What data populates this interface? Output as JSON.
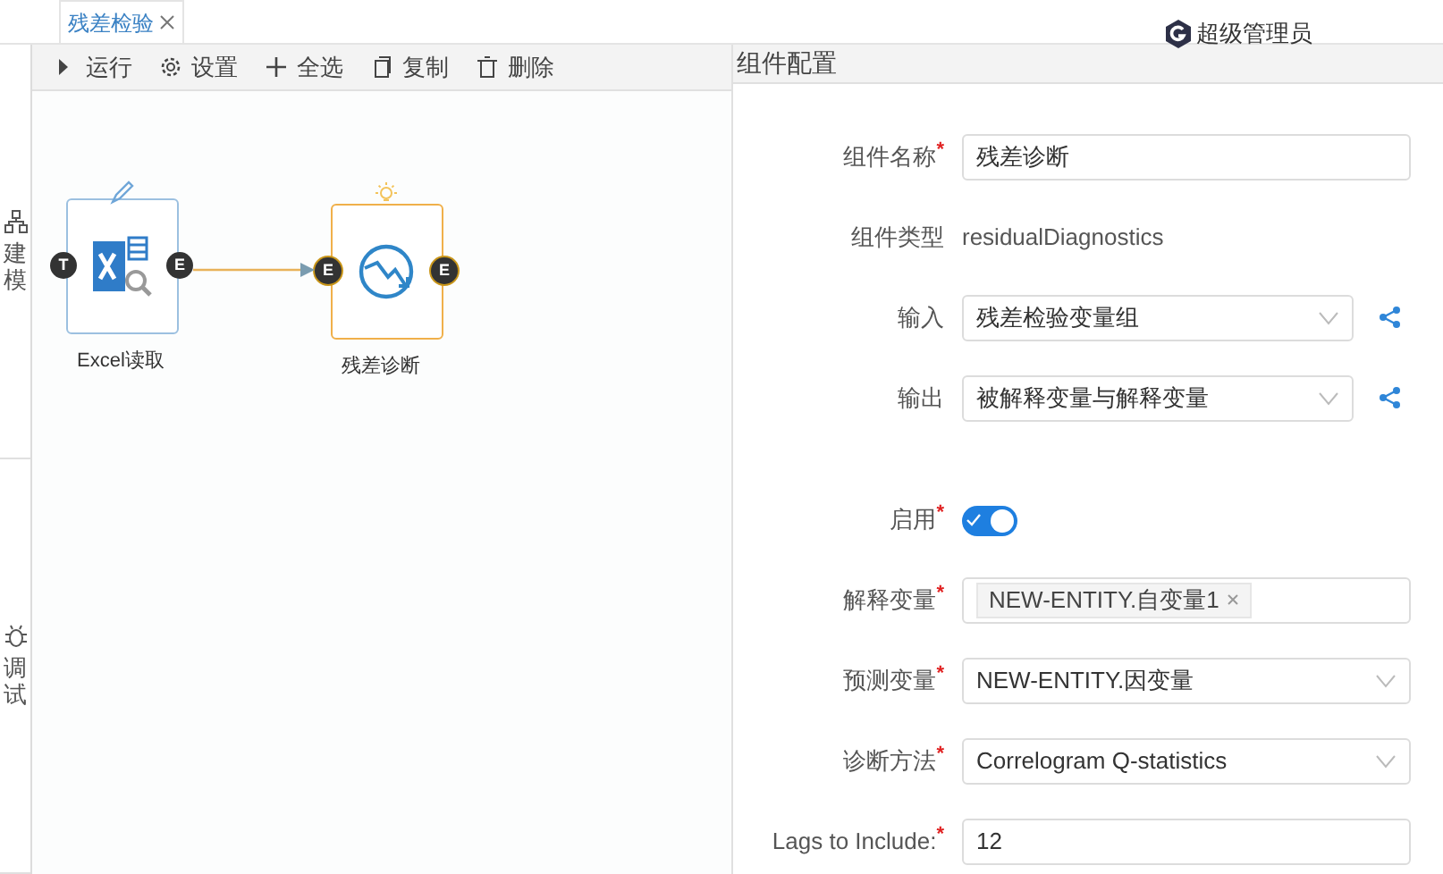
{
  "tabs": [
    {
      "label": "残差检验",
      "selected": true
    }
  ],
  "user": {
    "name": "超级管理员"
  },
  "sidebar": [
    {
      "label": "建模"
    },
    {
      "label": "调试"
    }
  ],
  "toolbar": [
    {
      "label": "运行"
    },
    {
      "label": "设置"
    },
    {
      "label": "全选"
    },
    {
      "label": "复制"
    },
    {
      "label": "删除"
    }
  ],
  "canvas": {
    "nodes": [
      {
        "label": "Excel读取",
        "kind": "excel",
        "selected": false,
        "in_port": "T",
        "out_port": "E"
      },
      {
        "label": "残差诊断",
        "kind": "residual",
        "selected": true,
        "in_port": "E",
        "out_port": "E"
      }
    ]
  },
  "panel": {
    "title": "组件配置",
    "fields": [
      {
        "kind": "text",
        "label": "组件名称",
        "required_mark": "*",
        "value": "残差诊断"
      },
      {
        "kind": "static",
        "label": "组件类型",
        "value": "residualDiagnostics"
      },
      {
        "kind": "select",
        "label": "输入",
        "value": "残差检验变量组",
        "share": true
      },
      {
        "kind": "select",
        "label": "输出",
        "value": "被解释变量与解释变量",
        "share": true
      },
      {
        "kind": "toggle",
        "label": "启用",
        "required_mark": "*",
        "on": true
      },
      {
        "kind": "tags",
        "label": "解释变量",
        "required_mark": "*",
        "tags": [
          "NEW-ENTITY.自变量1"
        ]
      },
      {
        "kind": "select",
        "label": "预测变量",
        "required_mark": "*",
        "value": "NEW-ENTITY.因变量",
        "share": false
      },
      {
        "kind": "select",
        "label": "诊断方法",
        "required_mark": "*",
        "value": "Correlogram Q-statistics",
        "share": false
      },
      {
        "kind": "text",
        "label": "Lags to Include:",
        "required_mark": "*",
        "value": "12"
      }
    ]
  }
}
